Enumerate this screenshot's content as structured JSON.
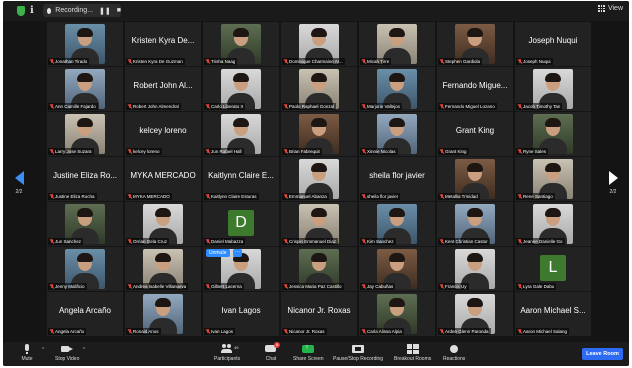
{
  "topbar": {
    "recording_label": "Recording...",
    "pause_icon": "pause-icon",
    "stop_icon": "stop-icon",
    "view_label": "View"
  },
  "navigation": {
    "left_page": "2/2",
    "right_page": "2/2"
  },
  "participants": [
    {
      "name": "Jonathan Tirado",
      "display": "photo",
      "bg": 0
    },
    {
      "name": "Kristen Kyra De Guzman",
      "display": "text",
      "tile_text": "Kristen Kyra De..."
    },
    {
      "name": "Trisha Naag",
      "display": "photo",
      "bg": 2
    },
    {
      "name": "Dominique Charmaine Ar...",
      "display": "photo",
      "bg": 3
    },
    {
      "name": "Micah Tirre",
      "display": "photo",
      "bg": 1
    },
    {
      "name": "Stephen Gardiola",
      "display": "photo",
      "bg": 4
    },
    {
      "name": "Joseph Nuqui",
      "display": "text",
      "tile_text": "Joseph Nuqui"
    },
    {
      "name": "Ann Camille Fajardo",
      "display": "photo",
      "bg": 5
    },
    {
      "name": "Robert John Almendral",
      "display": "text",
      "tile_text": "Robert John Al..."
    },
    {
      "name": "Carlo Liberato II",
      "display": "photo",
      "bg": 3
    },
    {
      "name": "Paolo Raphael Gonzal",
      "display": "photo",
      "bg": 1
    },
    {
      "name": "Marjorie Vallejos",
      "display": "photo",
      "bg": 0
    },
    {
      "name": "Fernando Miguel Lozano",
      "display": "text",
      "tile_text": "Fernando Migue..."
    },
    {
      "name": "Jacob Timothy Tan",
      "display": "photo",
      "bg": 3
    },
    {
      "name": "Larry Jose Suzara",
      "display": "photo",
      "bg": 1
    },
    {
      "name": "kelcey loreno",
      "display": "text",
      "tile_text": "kelcey loreno"
    },
    {
      "name": "Jun Rafael Hall",
      "display": "photo",
      "bg": 3
    },
    {
      "name": "Brian Fabrequit",
      "display": "photo",
      "bg": 4
    },
    {
      "name": "Xinnie Nicolas",
      "display": "photo",
      "bg": 5
    },
    {
      "name": "Grant King",
      "display": "text",
      "tile_text": "Grant King"
    },
    {
      "name": "Ryne Sales",
      "display": "photo",
      "bg": 2
    },
    {
      "name": "Justine Eliza Rocha",
      "display": "text",
      "tile_text": "Justine Eliza Ro..."
    },
    {
      "name": "MYKA MERCADO",
      "display": "text",
      "tile_text": "MYKA MERCADO"
    },
    {
      "name": "Kaitlynn Claire Esturas",
      "display": "text",
      "tile_text": "Kaitlynn Claire E..."
    },
    {
      "name": "Emmanuel Abanza",
      "display": "photo",
      "bg": 3
    },
    {
      "name": "sheila flor javier",
      "display": "text",
      "tile_text": "sheila flor javier"
    },
    {
      "name": "Metallia Trinidad",
      "display": "photo",
      "bg": 4
    },
    {
      "name": "Rene Santiago",
      "display": "photo",
      "bg": 1
    },
    {
      "name": "Jun Sanchez",
      "display": "photo",
      "bg": 2
    },
    {
      "name": "Orrian Gela Cruz",
      "display": "photo",
      "bg": 3
    },
    {
      "name": "Daniel Mabazza",
      "display": "avatar",
      "letter": "D",
      "color": "#3d7a2e"
    },
    {
      "name": "Crispin Emmanuel Diaz",
      "display": "photo",
      "bg": 1
    },
    {
      "name": "Kim Sanchez",
      "display": "photo",
      "bg": 0
    },
    {
      "name": "Kent Christian Castor",
      "display": "photo",
      "bg": 5
    },
    {
      "name": "Jeanne Danielle Go",
      "display": "photo",
      "bg": 3
    },
    {
      "name": "Jenny Malificio",
      "display": "photo",
      "bg": 0
    },
    {
      "name": "Andrea Isabelle Villanueva",
      "display": "photo",
      "bg": 1
    },
    {
      "name": "Gilbert Lacerna",
      "display": "photo",
      "bg": 3,
      "unmute": "Unmute",
      "more": "···"
    },
    {
      "name": "Jessica Maria Paz Castillo",
      "display": "photo",
      "bg": 2
    },
    {
      "name": "Jay Cabuñas",
      "display": "photo",
      "bg": 4
    },
    {
      "name": "Francis Uy",
      "display": "photo",
      "bg": 3
    },
    {
      "name": "Lyra Gale Dabu",
      "display": "avatar",
      "letter": "L",
      "color": "#3d7a2e"
    },
    {
      "name": "Angela Arcaño",
      "display": "text",
      "tile_text": "Angela Arcaño"
    },
    {
      "name": "Ronald Anos",
      "display": "photo",
      "bg": 5
    },
    {
      "name": "Ivan Lagos",
      "display": "text",
      "tile_text": "Ivan Lagos"
    },
    {
      "name": "Nicanor Jr. Roxas",
      "display": "text",
      "tile_text": "Nicanor Jr. Roxas"
    },
    {
      "name": "Carla Alissa Alpia",
      "display": "photo",
      "bg": 2
    },
    {
      "name": "Arden Glenn Paronda",
      "display": "photo",
      "bg": 3
    },
    {
      "name": "Aaron Michael Salang",
      "display": "text",
      "tile_text": "Aaron Michael S..."
    }
  ],
  "toolbar": {
    "mute": "Mute",
    "stop_video": "Stop Video",
    "participants": "Participants",
    "participants_count": "49",
    "chat": "Chat",
    "chat_badge": "8",
    "share_screen": "Share Screen",
    "pause_stop_recording": "Pause/Stop Recording",
    "breakout_rooms": "Breakout Rooms",
    "reactions": "Reactions",
    "leave_room": "Leave Room"
  },
  "colors": {
    "share_green": "#24b34b",
    "leave_blue": "#2d6bf5",
    "muted_red": "#e0443c"
  }
}
